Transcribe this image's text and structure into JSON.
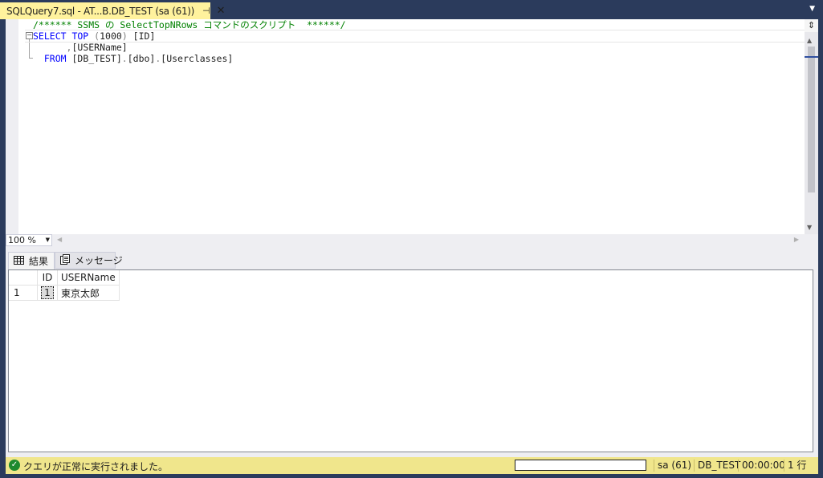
{
  "tab": {
    "title": "SQLQuery7.sql - AT...B.DB_TEST (sa (61))",
    "pin_glyph": "⊣",
    "close_glyph": "✕"
  },
  "editor": {
    "lines": [
      {
        "parts": [
          {
            "t": "/****** SSMS の SelectTopNRows コマンドのスクリプト  ******/",
            "c": "cmt"
          }
        ]
      },
      {
        "parts": [
          {
            "t": "SELECT TOP ",
            "c": "kw"
          },
          {
            "t": "(",
            "c": "gray"
          },
          {
            "t": "1000",
            "c": "plain"
          },
          {
            "t": ") ",
            "c": "gray"
          },
          {
            "t": "[ID]",
            "c": "plain"
          }
        ]
      },
      {
        "parts": [
          {
            "t": "      ",
            "c": "plain"
          },
          {
            "t": ",",
            "c": "gray"
          },
          {
            "t": "[USERName]",
            "c": "plain"
          }
        ]
      },
      {
        "parts": [
          {
            "t": "  FROM ",
            "c": "kw"
          },
          {
            "t": "[DB_TEST]",
            "c": "plain"
          },
          {
            "t": ".",
            "c": "gray"
          },
          {
            "t": "[dbo]",
            "c": "plain"
          },
          {
            "t": ".",
            "c": "gray"
          },
          {
            "t": "[Userclasses]",
            "c": "plain"
          }
        ]
      }
    ]
  },
  "zoom": {
    "value": "100 %"
  },
  "results": {
    "tabs": [
      {
        "label": "結果",
        "icon": "grid-icon"
      },
      {
        "label": "メッセージ",
        "icon": "message-icon"
      }
    ],
    "columns": [
      "ID",
      "USERName"
    ],
    "rows": [
      {
        "num": "1",
        "cells": [
          "1",
          "東京太郎"
        ]
      }
    ]
  },
  "status": {
    "message": "クエリが正常に実行されました。",
    "user": "sa (61)",
    "database": "DB_TEST",
    "elapsed": "00:00:00",
    "rows": "1 行",
    "colors": {
      "bar": "#f0e68c",
      "ok": "#1e8a2e"
    }
  }
}
